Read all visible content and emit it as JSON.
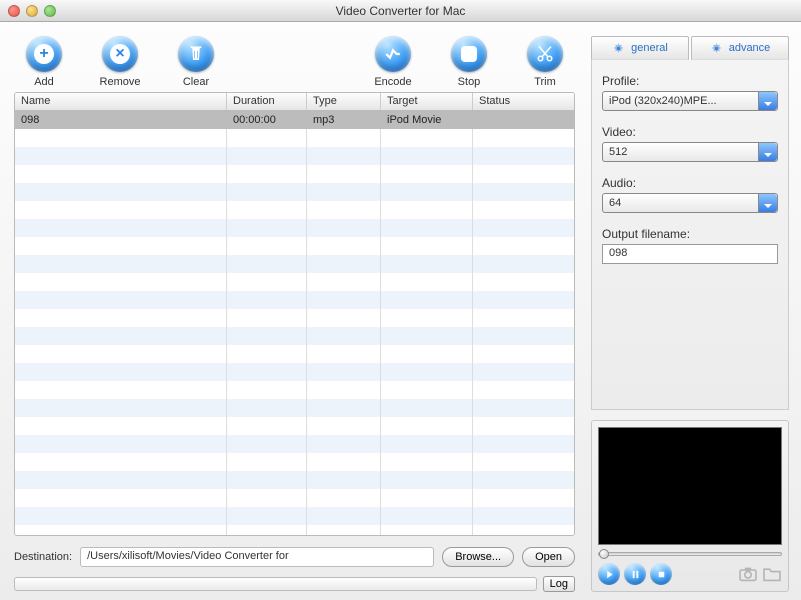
{
  "window": {
    "title": "Video Converter for Mac"
  },
  "toolbar": {
    "left": [
      {
        "key": "add",
        "label": "Add"
      },
      {
        "key": "remove",
        "label": "Remove"
      },
      {
        "key": "clear",
        "label": "Clear"
      }
    ],
    "right": [
      {
        "key": "encode",
        "label": "Encode"
      },
      {
        "key": "stop",
        "label": "Stop"
      },
      {
        "key": "trim",
        "label": "Trim"
      }
    ]
  },
  "columns": {
    "name": "Name",
    "duration": "Duration",
    "type": "Type",
    "target": "Target",
    "status": "Status"
  },
  "rows": [
    {
      "name": "098",
      "duration": "00:00:00",
      "type": "mp3",
      "target": "iPod Movie",
      "status": "",
      "selected": true
    }
  ],
  "destination": {
    "label": "Destination:",
    "path": "/Users/xilisoft/Movies/Video Converter for",
    "browse": "Browse...",
    "open": "Open"
  },
  "log_btn": "Log",
  "tabs": {
    "general": "general",
    "advance": "advance"
  },
  "settings": {
    "profile_label": "Profile:",
    "profile": "iPod (320x240)MPE...",
    "video_label": "Video:",
    "video": "512",
    "audio_label": "Audio:",
    "audio": "64",
    "output_label": "Output filename:",
    "output": "098"
  }
}
